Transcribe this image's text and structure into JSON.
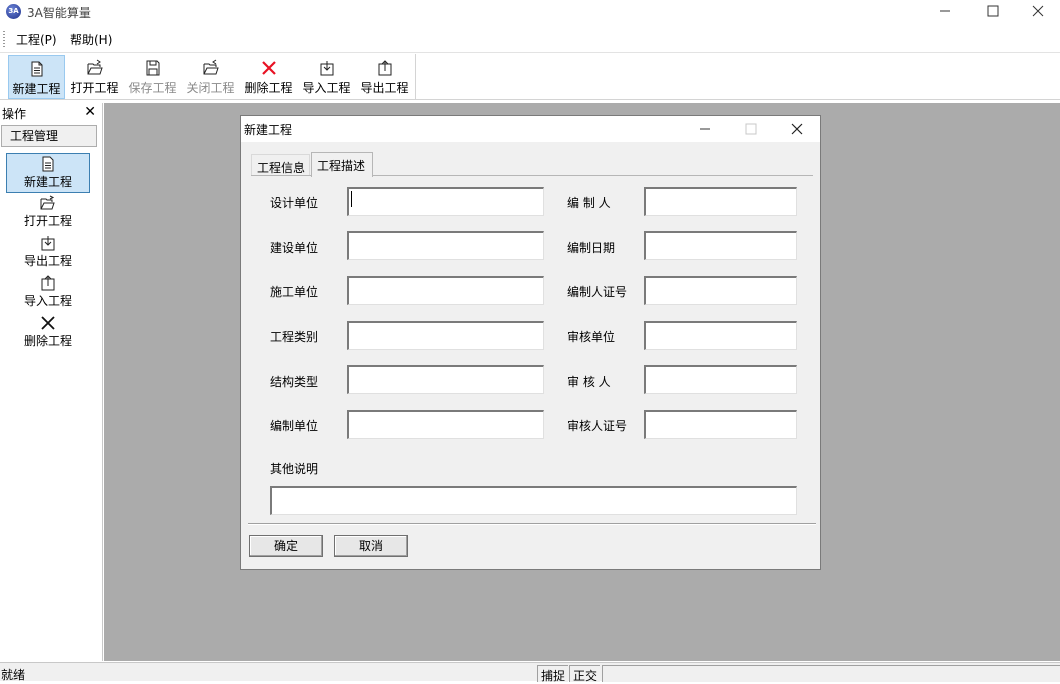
{
  "app": {
    "title": "3A智能算量",
    "icon_text": "3A"
  },
  "menu": {
    "items": [
      "工程(P)",
      "帮助(H)"
    ]
  },
  "toolbar": {
    "new": "新建工程",
    "open": "打开工程",
    "save": "保存工程",
    "close": "关闭工程",
    "delete": "删除工程",
    "import": "导入工程",
    "export": "导出工程"
  },
  "left_panel": {
    "title": "操作",
    "tab": "工程管理",
    "items": [
      "新建工程",
      "打开工程",
      "导出工程",
      "导入工程",
      "删除工程"
    ]
  },
  "dialog": {
    "title": "新建工程",
    "tabs": [
      "工程信息",
      "工程描述"
    ],
    "active_tab": "工程描述",
    "fields_left": [
      "设计单位",
      "建设单位",
      "施工单位",
      "工程类别",
      "结构类型",
      "编制单位"
    ],
    "fields_right": [
      "编 制 人",
      "编制日期",
      "编制人证号",
      "审核单位",
      "审 核 人",
      "审核人证号"
    ],
    "other_label": "其他说明",
    "ok": "确定",
    "cancel": "取消"
  },
  "status": {
    "text": "就绪",
    "snap": "捕捉",
    "ortho": "正交"
  },
  "colors": {
    "workspace": "#ababab",
    "selected": "#cce4f7",
    "delete_red": "#e81123"
  }
}
